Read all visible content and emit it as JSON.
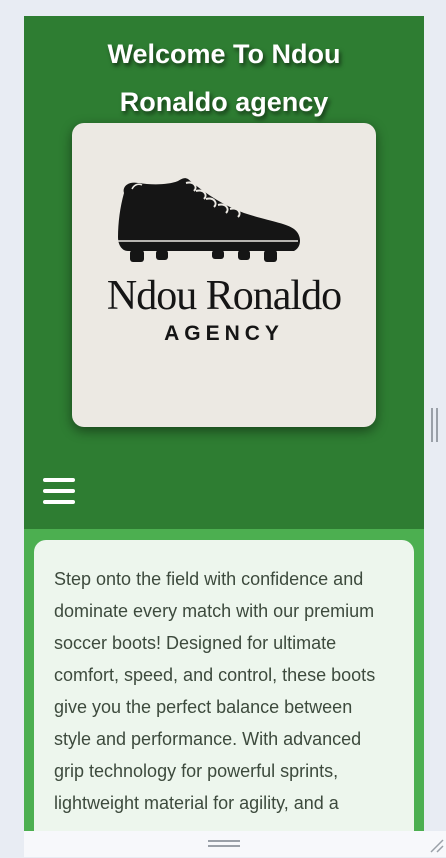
{
  "header": {
    "title_line1": "Welcome To Ndou",
    "title_line2": "Ronaldo agency",
    "background_color": "#2e7d32",
    "title_color": "#ffffff"
  },
  "logo": {
    "brand_name": "Ndou Ronaldo",
    "brand_sub": "AGENCY",
    "icon": "soccer-boot-icon",
    "card_color": "#ece9e3"
  },
  "nav": {
    "menu_icon": "hamburger-menu-icon"
  },
  "main": {
    "background_color": "#4caf50",
    "card_color": "#edf6ed",
    "description": "Step onto the field with confidence and dominate every match with our premium soccer boots! Designed for ultimate comfort, speed, and control, these boots give you the perfect balance between style and performance. With advanced grip technology for powerful sprints, lightweight material for agility, and a"
  }
}
